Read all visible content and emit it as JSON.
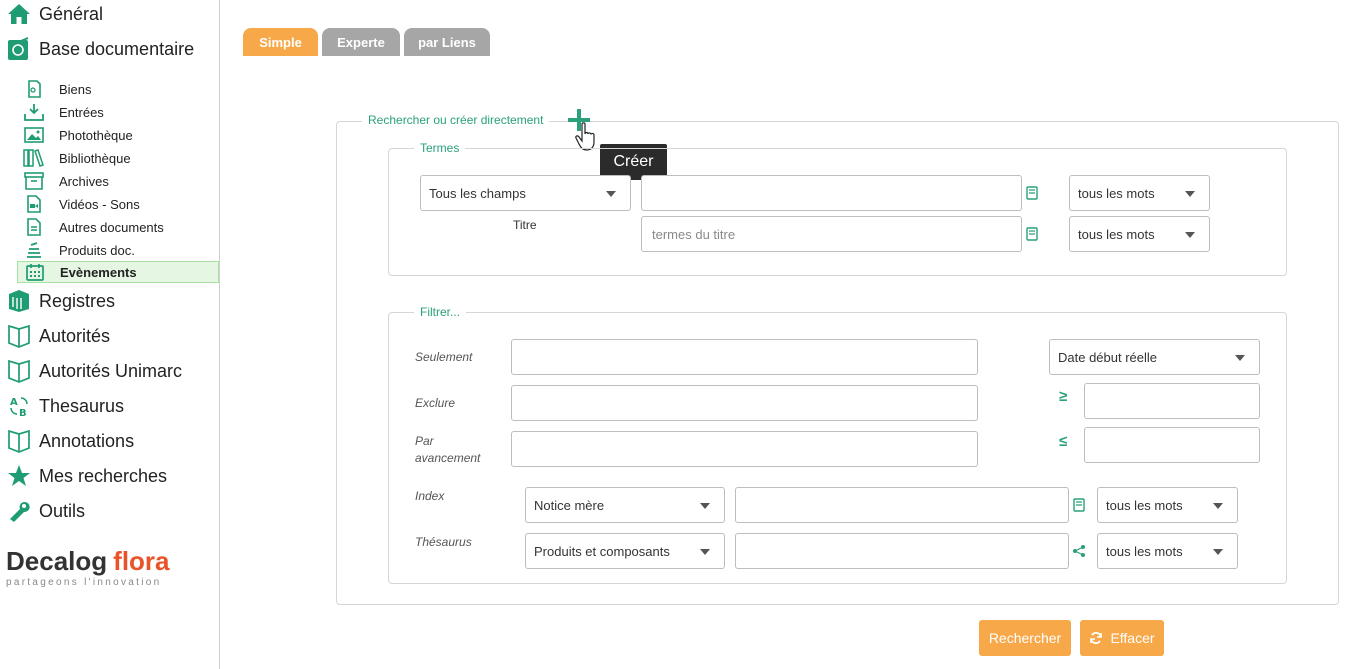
{
  "sidebar": {
    "top_items": [
      {
        "label": "Général",
        "icon": "home-icon"
      },
      {
        "label": "Base documentaire",
        "icon": "database-icon"
      }
    ],
    "sub_items": [
      {
        "label": "Biens",
        "icon": "document-icon"
      },
      {
        "label": "Entrées",
        "icon": "inbox-download-icon"
      },
      {
        "label": "Photothèque",
        "icon": "photo-icon"
      },
      {
        "label": "Bibliothèque",
        "icon": "books-icon"
      },
      {
        "label": "Archives",
        "icon": "archive-box-icon"
      },
      {
        "label": "Vidéos - Sons",
        "icon": "video-file-icon"
      },
      {
        "label": "Autres documents",
        "icon": "file-text-icon"
      },
      {
        "label": "Produits doc.",
        "icon": "stack-icon"
      },
      {
        "label": "Evènements",
        "icon": "calendar-icon"
      }
    ],
    "bottom_items": [
      {
        "label": "Registres",
        "icon": "registers-icon"
      },
      {
        "label": "Autorités",
        "icon": "open-book-icon"
      },
      {
        "label": "Autorités Unimarc",
        "icon": "open-book-icon"
      },
      {
        "label": "Thesaurus",
        "icon": "thesaurus-icon"
      },
      {
        "label": "Annotations",
        "icon": "open-book-icon"
      },
      {
        "label": "Mes recherches",
        "icon": "star-icon"
      },
      {
        "label": "Outils",
        "icon": "wrench-icon"
      }
    ],
    "logo": {
      "brand_part1": "Decalog",
      "brand_part2": "flora",
      "tagline": "partageons l'innovation"
    }
  },
  "tabs": [
    {
      "label": "Simple",
      "active": true
    },
    {
      "label": "Experte",
      "active": false
    },
    {
      "label": "par Liens",
      "active": false
    }
  ],
  "search_panel": {
    "legend": "Rechercher ou créer directement",
    "create_tooltip": "Créer",
    "termes": {
      "legend": "Termes",
      "row1": {
        "field_select": "Tous les champs",
        "value": "",
        "mode": "tous les mots"
      },
      "row2": {
        "label": "Titre",
        "placeholder": "termes du titre",
        "mode": "tous les mots"
      }
    },
    "filtrer": {
      "legend": "Filtrer...",
      "seulement_label": "Seulement",
      "exclure_label": "Exclure",
      "par_avancement_label": "Par avancement",
      "date_select": "Date début réelle",
      "gte_symbol": "≥",
      "lte_symbol": "≤",
      "index": {
        "label": "Index",
        "select": "Notice mère",
        "value": "",
        "mode": "tous les mots"
      },
      "thesaurus": {
        "label": "Thésaurus",
        "select": "Produits et composants",
        "value": "",
        "mode": "tous les mots"
      }
    }
  },
  "actions": {
    "search_label": "Rechercher",
    "clear_label": "Effacer"
  },
  "colors": {
    "accent_green": "#2aa07c",
    "orange": "#f7a94a",
    "inactive_tab": "#a6a6a6",
    "logo_orange": "#e8542a"
  }
}
